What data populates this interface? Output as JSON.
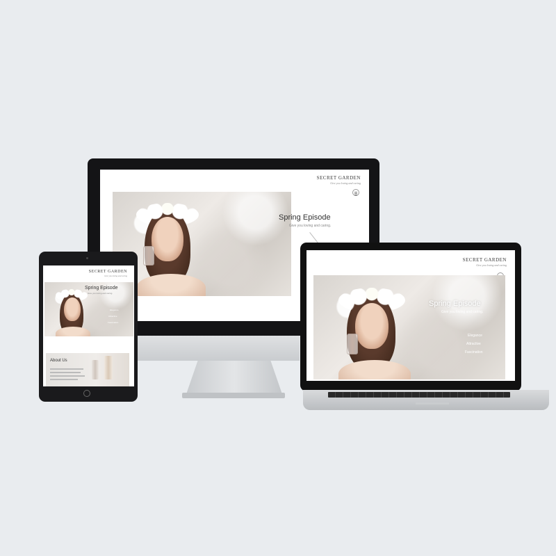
{
  "site": {
    "brand": "SECRET GARDEN",
    "tagline": "Give you loving and caring",
    "hero_title": "Spring Episode",
    "hero_subtitle": "Give you loving and caring.",
    "nav": [
      "Elegance",
      "Attractive",
      "Fascination"
    ],
    "about_title": "About Us"
  },
  "devices": [
    "desktop-monitor",
    "laptop",
    "tablet"
  ],
  "icons": {
    "menu": "hamburger-menu-icon"
  },
  "colors": {
    "background": "#e9ecef",
    "bezel": "#141416",
    "text_dark": "#333333",
    "text_muted": "#8a8a8a"
  }
}
